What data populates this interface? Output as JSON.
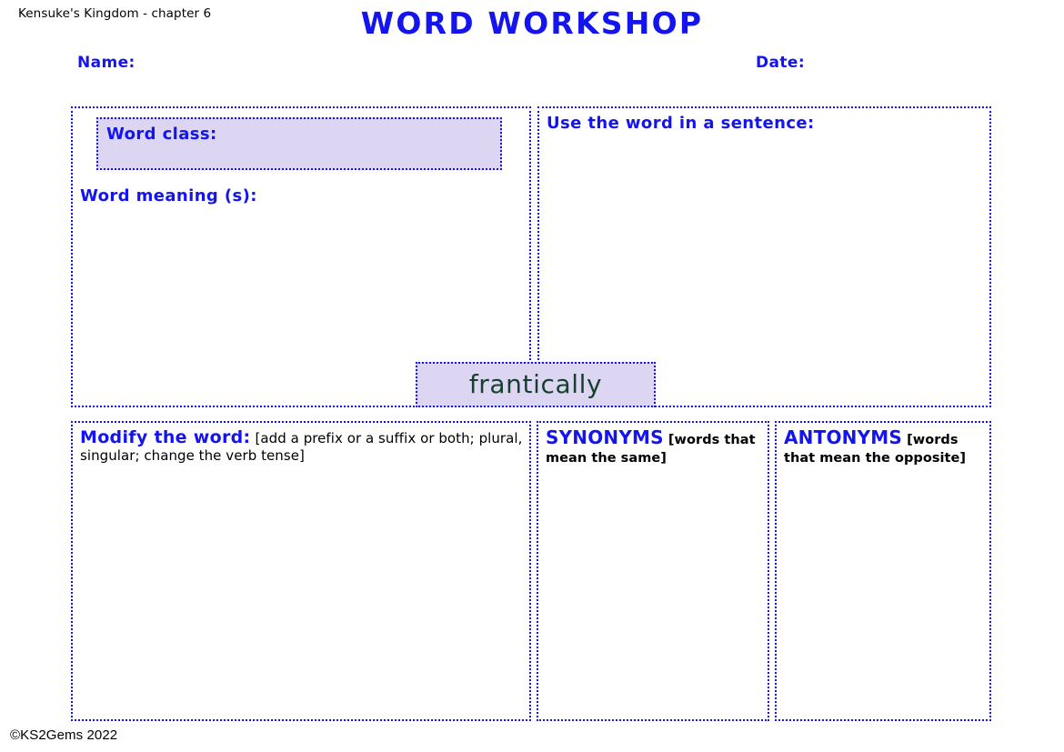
{
  "header": {
    "book_reference": "Kensuke's Kingdom - chapter 6",
    "title": "WORD WORKSHOP",
    "name_label": "Name:",
    "date_label": "Date:"
  },
  "focus_word": {
    "text": "frantically"
  },
  "sections": {
    "word_class": {
      "label": "Word class:",
      "value": ""
    },
    "word_meaning": {
      "label": "Word meaning (s):",
      "value": ""
    },
    "sentence": {
      "label": "Use the word in a sentence:",
      "value": ""
    },
    "modify": {
      "label": "Modify the word:",
      "note": "[add a prefix or a suffix or both; plural, singular; change the verb tense]",
      "value": ""
    },
    "synonyms": {
      "label": "SYNONYMS",
      "note": "[words that mean the same]",
      "value": ""
    },
    "antonyms": {
      "label": "ANTONYMS",
      "note": "[words that mean the opposite]",
      "value": ""
    }
  },
  "footer": {
    "copyright": "©KS2Gems 2022"
  },
  "colors": {
    "accent_blue": "#1414f0",
    "box_fill_lavender": "#dcd6f2",
    "focus_word_green": "#17402f",
    "body_text_black": "#000000"
  }
}
